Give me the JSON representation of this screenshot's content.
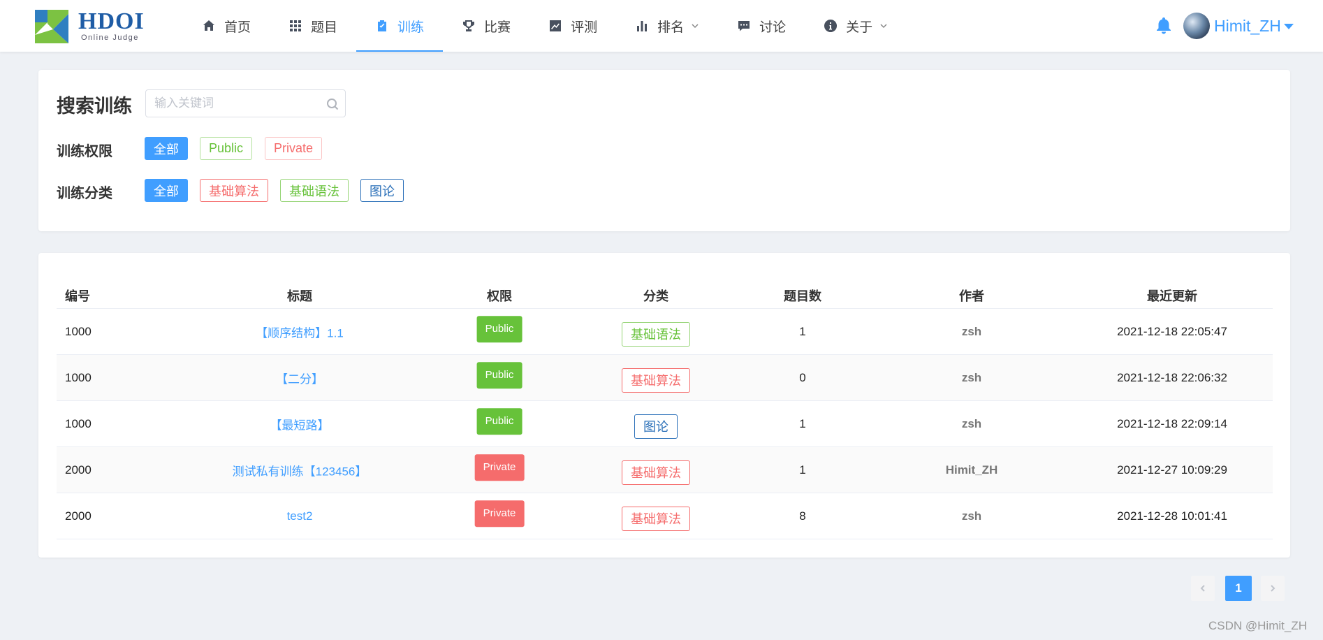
{
  "brand": {
    "name": "HDOI",
    "subtitle": "Online Judge"
  },
  "nav": [
    {
      "label": "首页",
      "icon": "home-icon"
    },
    {
      "label": "题目",
      "icon": "grid-icon"
    },
    {
      "label": "训练",
      "icon": "clipboard-check-icon",
      "active": true
    },
    {
      "label": "比赛",
      "icon": "trophy-icon"
    },
    {
      "label": "评测",
      "icon": "trend-chart-icon"
    },
    {
      "label": "排名",
      "icon": "bar-chart-icon",
      "dropdown": true
    },
    {
      "label": "讨论",
      "icon": "chat-icon"
    },
    {
      "label": "关于",
      "icon": "info-icon",
      "dropdown": true
    }
  ],
  "user": {
    "name": "Himit_ZH"
  },
  "accent_color": "#409eff",
  "filter": {
    "title": "搜索训练",
    "search_placeholder": "输入关键词",
    "permission_label": "训练权限",
    "permission_options": [
      "全部",
      "Public",
      "Private"
    ],
    "category_label": "训练分类",
    "category_options": [
      "全部",
      "基础算法",
      "基础语法",
      "图论"
    ]
  },
  "table": {
    "columns": [
      "编号",
      "标题",
      "权限",
      "分类",
      "题目数",
      "作者",
      "最近更新"
    ],
    "rows": [
      {
        "id": "1000",
        "title": "【顺序结构】1.1",
        "permission": "Public",
        "category": "基础语法",
        "count": "1",
        "author": "zsh",
        "updated": "2021-12-18 22:05:47"
      },
      {
        "id": "1000",
        "title": "【二分】",
        "permission": "Public",
        "category": "基础算法",
        "count": "0",
        "author": "zsh",
        "updated": "2021-12-18 22:06:32"
      },
      {
        "id": "1000",
        "title": "【最短路】",
        "permission": "Public",
        "category": "图论",
        "count": "1",
        "author": "zsh",
        "updated": "2021-12-18 22:09:14"
      },
      {
        "id": "2000",
        "title": "测试私有训练【123456】",
        "permission": "Private",
        "category": "基础算法",
        "count": "1",
        "author": "Himit_ZH",
        "updated": "2021-12-27 10:09:29"
      },
      {
        "id": "2000",
        "title": "test2",
        "permission": "Private",
        "category": "基础算法",
        "count": "8",
        "author": "zsh",
        "updated": "2021-12-28 10:01:41"
      }
    ]
  },
  "pagination": {
    "current": "1"
  },
  "watermark": "CSDN @Himit_ZH"
}
